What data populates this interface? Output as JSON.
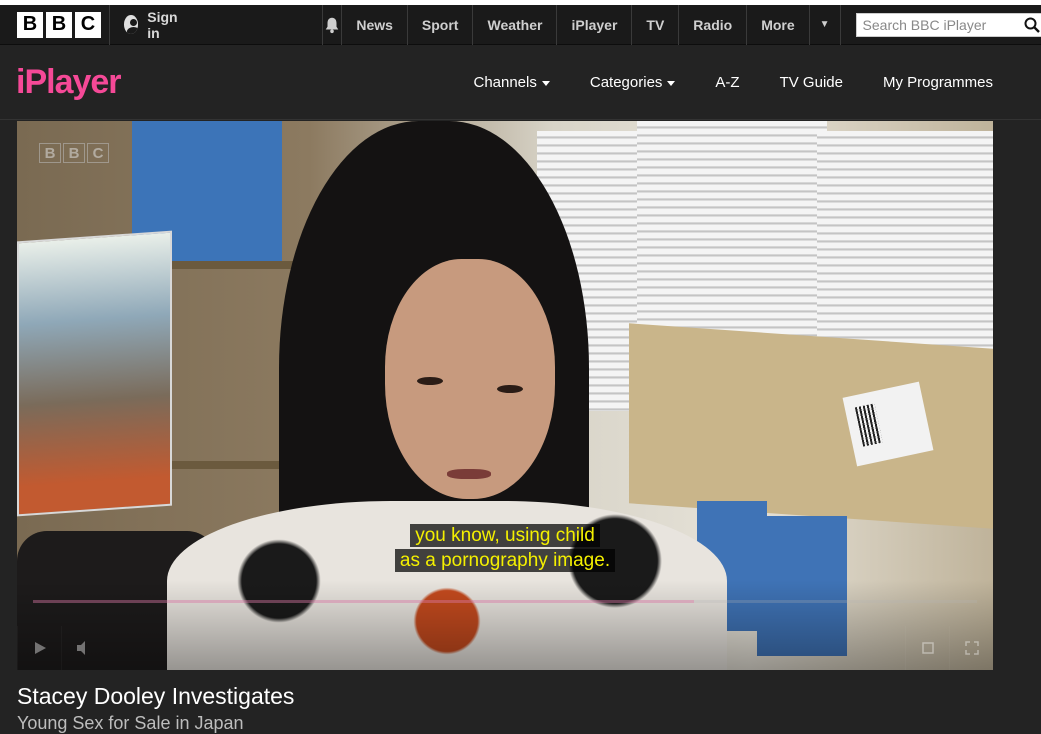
{
  "bbc_bar": {
    "logo_letters": [
      "B",
      "B",
      "C"
    ],
    "signin_label": "Sign in",
    "nav_links": [
      "News",
      "Sport",
      "Weather",
      "iPlayer",
      "TV",
      "Radio",
      "More"
    ],
    "search_placeholder": "Search BBC iPlayer"
  },
  "iplayer": {
    "logo_text": "iPlayer",
    "logo_color": "#f54997",
    "nav": [
      {
        "label": "Channels",
        "has_dropdown": true
      },
      {
        "label": "Categories",
        "has_dropdown": true
      },
      {
        "label": "A-Z",
        "has_dropdown": false
      },
      {
        "label": "TV Guide",
        "has_dropdown": false
      },
      {
        "label": "My Programmes",
        "has_dropdown": false
      }
    ]
  },
  "player": {
    "watermark_letters": [
      "B",
      "B",
      "C"
    ],
    "subtitle_lines": [
      "you know, using child",
      "as a pornography image."
    ],
    "subtitle_color": "#f4f000",
    "progress_fraction": 0.7
  },
  "programme": {
    "title": "Stacey Dooley Investigates",
    "episode": "Young Sex for Sale in Japan"
  }
}
